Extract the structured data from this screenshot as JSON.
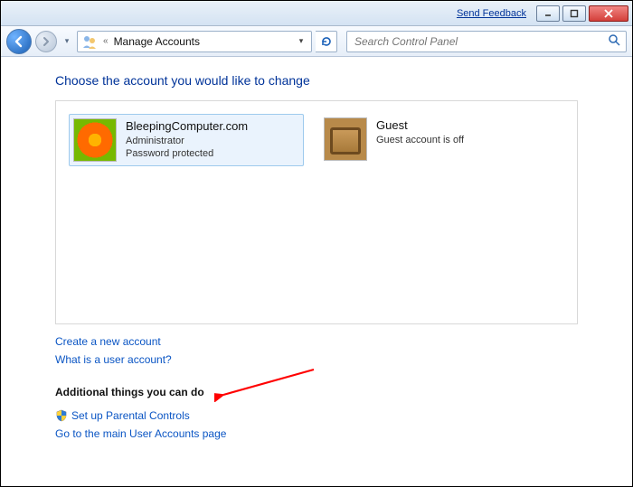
{
  "titlebar": {
    "feedback": "Send Feedback"
  },
  "breadcrumb": {
    "title": "Manage Accounts"
  },
  "search": {
    "placeholder": "Search Control Panel"
  },
  "heading": "Choose the account you would like to change",
  "accounts": [
    {
      "name": "BleepingComputer.com",
      "role": "Administrator",
      "status": "Password protected"
    },
    {
      "name": "Guest",
      "role": "",
      "status": "Guest account is off"
    }
  ],
  "links": {
    "create": "Create a new account",
    "what_is": "What is a user account?"
  },
  "additional": {
    "heading": "Additional things you can do",
    "parental": "Set up Parental Controls",
    "main_page": "Go to the main User Accounts page"
  }
}
